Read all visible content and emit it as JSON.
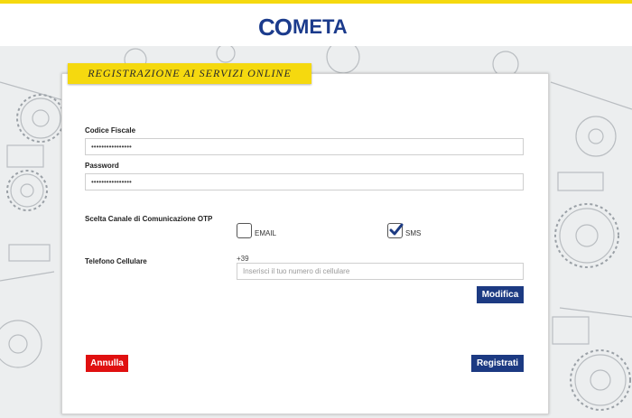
{
  "brand": {
    "logo_part1": "CO",
    "logo_part2": "META"
  },
  "form": {
    "section_title": "Registrazione ai servizi online",
    "codice_fiscale_label": "Codice Fiscale",
    "codice_fiscale_value": "••••••••••••••••",
    "password_label": "Password",
    "password_value": "••••••••••••••••",
    "otp_label": "Scelta Canale di Comunicazione OTP",
    "email_option": "EMAIL",
    "email_checked": false,
    "sms_option": "SMS",
    "sms_checked": true,
    "phone_label": "Telefono Cellulare",
    "phone_prefix": "+39",
    "phone_placeholder": "Inserisci il tuo numero di cellulare",
    "modify_button": "Modifica",
    "cancel_button": "Annulla",
    "register_button": "Registrati"
  },
  "colors": {
    "accent_yellow": "#f5d90f",
    "brand_blue": "#1c3a82",
    "cancel_red": "#e01010"
  }
}
